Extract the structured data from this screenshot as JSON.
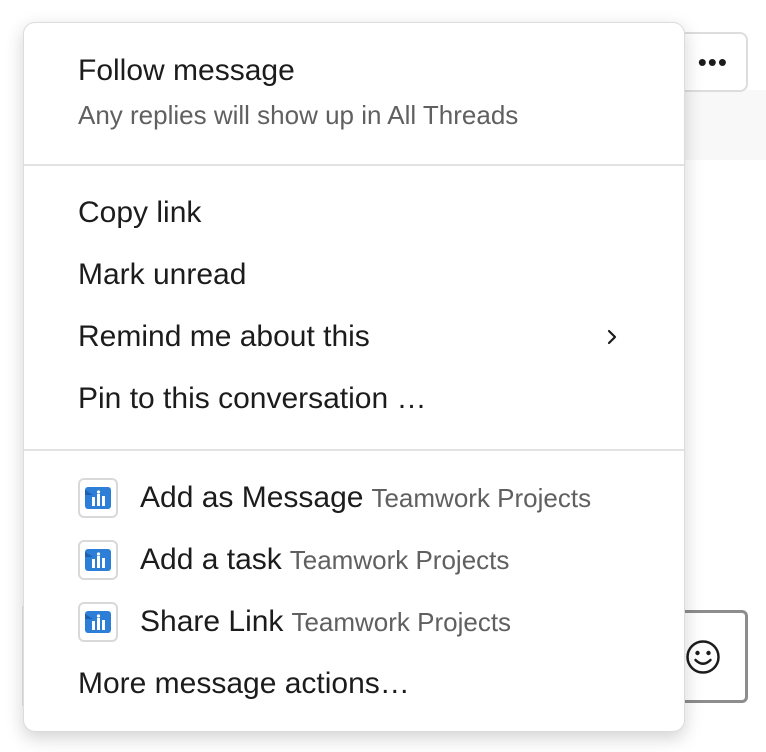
{
  "background": {
    "more_button_label": "•••",
    "emoji_button_icon": "smiley-icon"
  },
  "menu": {
    "follow": {
      "title": "Follow message",
      "subtitle": "Any replies will show up in All Threads"
    },
    "actions": [
      {
        "label": "Copy link"
      },
      {
        "label": "Mark unread"
      },
      {
        "label": "Remind me about this",
        "has_submenu": true,
        "icon": "chevron-right-icon"
      },
      {
        "label": "Pin to this conversation …"
      }
    ],
    "app_actions": [
      {
        "label": "Add as Message",
        "app": "Teamwork Projects",
        "icon": "teamwork-projects-icon"
      },
      {
        "label": "Add a task",
        "app": "Teamwork Projects",
        "icon": "teamwork-projects-icon"
      },
      {
        "label": "Share Link",
        "app": "Teamwork Projects",
        "icon": "teamwork-projects-icon"
      }
    ],
    "more_actions": "More message actions…"
  },
  "colors": {
    "text_primary": "#1d1c1d",
    "text_secondary": "#616061",
    "divider": "#e2e2e2",
    "teamwork_blue": "#2c7ed6"
  }
}
